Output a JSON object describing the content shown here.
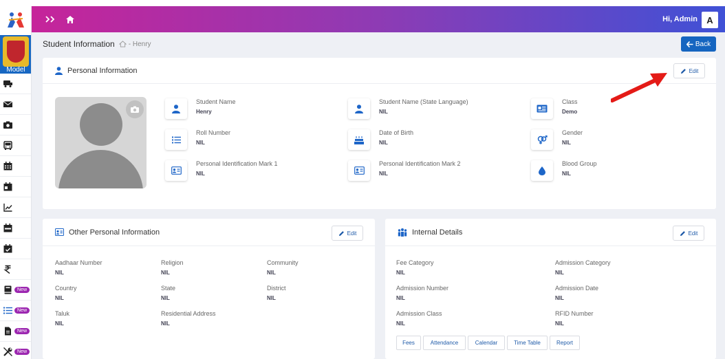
{
  "sidebar": {
    "school_name": "Model",
    "items": [
      {
        "icon": "bus-icon",
        "new": ""
      },
      {
        "icon": "mail-icon",
        "new": ""
      },
      {
        "icon": "camera-icon",
        "new": ""
      },
      {
        "icon": "bus-front-icon",
        "new": ""
      },
      {
        "icon": "calendar-icon",
        "new": ""
      },
      {
        "icon": "calendar-day-icon",
        "new": ""
      },
      {
        "icon": "chart-line-icon",
        "new": ""
      },
      {
        "icon": "calendar-week-icon",
        "new": ""
      },
      {
        "icon": "calendar-check-icon",
        "new": ""
      },
      {
        "icon": "rupee-icon",
        "new": ""
      },
      {
        "icon": "book-icon",
        "new": "New"
      },
      {
        "icon": "list-icon",
        "new": "New"
      },
      {
        "icon": "document-icon",
        "new": "New"
      },
      {
        "icon": "wrench-icon",
        "new": "New"
      }
    ]
  },
  "topbar": {
    "greeting": "Hi,  Admin",
    "avatar_letter": "A"
  },
  "page": {
    "title": "Student Information",
    "breadcrumb": "- Henry",
    "back_label": "Back"
  },
  "personal": {
    "title": "Personal Information",
    "edit_label": "Edit",
    "fields": [
      {
        "label": "Student Name",
        "value": "Henry",
        "icon": "user-icon"
      },
      {
        "label": "Student Name (State Language)",
        "value": "NIL",
        "icon": "user-icon"
      },
      {
        "label": "Class",
        "value": "Demo",
        "icon": "id-card-icon"
      },
      {
        "label": "Roll Number",
        "value": "NIL",
        "icon": "list-icon"
      },
      {
        "label": "Date of Birth",
        "value": "NIL",
        "icon": "birthday-cake-icon"
      },
      {
        "label": "Gender",
        "value": "NIL",
        "icon": "gender-icon"
      },
      {
        "label": "Personal Identification Mark 1",
        "value": "NIL",
        "icon": "id-badge-icon"
      },
      {
        "label": "Personal Identification Mark 2",
        "value": "NIL",
        "icon": "id-badge-icon"
      },
      {
        "label": "Blood Group",
        "value": "NIL",
        "icon": "blood-drop-icon"
      }
    ]
  },
  "other": {
    "title": "Other Personal Information",
    "edit_label": "Edit",
    "fields": [
      {
        "label": "Aadhaar Number",
        "value": "NIL"
      },
      {
        "label": "Religion",
        "value": "NIL"
      },
      {
        "label": "Community",
        "value": "NIL"
      },
      {
        "label": "Country",
        "value": "NIL"
      },
      {
        "label": "State",
        "value": "NIL"
      },
      {
        "label": "District",
        "value": "NIL"
      },
      {
        "label": "Taluk",
        "value": "NIL"
      },
      {
        "label": "Residential Address",
        "value": "NIL"
      }
    ]
  },
  "internal": {
    "title": "Internal Details",
    "edit_label": "Edit",
    "fields": [
      {
        "label": "Fee Category",
        "value": "NIL"
      },
      {
        "label": "Admission Category",
        "value": "NIL"
      },
      {
        "label": "Admission Number",
        "value": "NIL"
      },
      {
        "label": "Admission Date",
        "value": "NIL"
      },
      {
        "label": "Admission Class",
        "value": "NIL"
      },
      {
        "label": "RFID Number",
        "value": "NIL"
      }
    ],
    "buttons": [
      "Fees",
      "Attendance",
      "Calendar",
      "Time Table",
      "Report"
    ]
  },
  "colors": {
    "accent": "#1565c0",
    "gradient_start": "#c6249a",
    "gradient_end": "#3f51d6",
    "badge": "#9c27b0",
    "arrow": "#e41b17"
  }
}
